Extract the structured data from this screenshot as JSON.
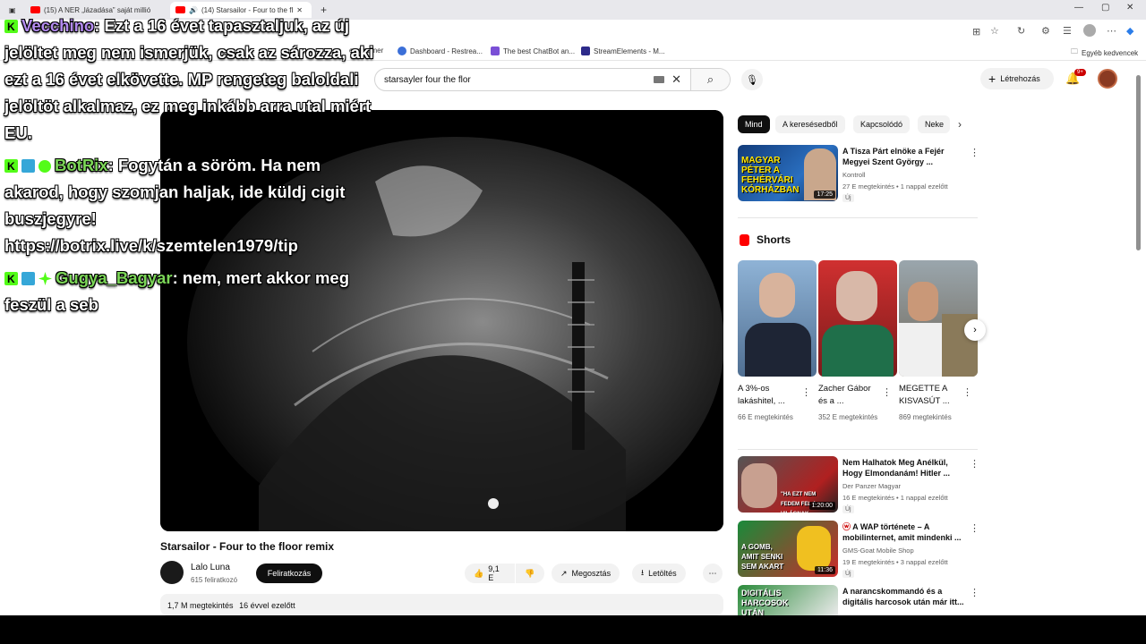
{
  "browser": {
    "tabs": [
      {
        "label": "(15) A NER „lázadása” saját millió"
      },
      {
        "label": "(14) Starsailor - Four to the fl"
      }
    ],
    "new_tab": "+",
    "bookmarks": [
      {
        "label": "e streamer"
      },
      {
        "label": "Dashboard - Restrea..."
      },
      {
        "label": "The best ChatBot an..."
      },
      {
        "label": "StreamElements - M..."
      }
    ],
    "other_favorites": "Egyéb kedvencek"
  },
  "header": {
    "search_query": "starsayler four the flor",
    "create_label": "Létrehozás",
    "notif_badge": "9+"
  },
  "video": {
    "title": "Starsailor - Four to the floor remix",
    "channel": "Lalo Luna",
    "subscribers": "615 feliratkozó",
    "subscribe_label": "Feliratkozás",
    "likes": "9,1 E",
    "share_label": "Megosztás",
    "download_label": "Letöltés",
    "views": "1,7 M megtekintés",
    "age": "16 évvel ezelőtt"
  },
  "chips": [
    "Mind",
    "A keresésedből",
    "Kapcsolódó",
    "Neke"
  ],
  "related_top": {
    "title": "A Tisza Párt elnöke a Fejér Megyei Szent György ...",
    "channel": "Kontroll",
    "meta": "27 E megtekintés • 1 nappal ezelőtt",
    "badge": "Új",
    "duration": "17:25",
    "thumb_text": "MAGYAR PÉTER A FEHÉRVÁRI KÓRHÁZBAN"
  },
  "shorts": {
    "title": "Shorts",
    "items": [
      {
        "title": "A 3%-os lakáshitel, ...",
        "views": "66 E megtekintés"
      },
      {
        "title": "Zacher Gábor és a ...",
        "views": "352 E megtekintés"
      },
      {
        "title": "MEGETTE A KISVASÚT ...",
        "views": "869 megtekintés"
      }
    ]
  },
  "related": [
    {
      "title": "Nem Halhatok Meg Anélkül, Hogy Elmondanám! Hitler ...",
      "channel": "Der Panzer Magyar",
      "meta": "16 E megtekintés • 1 nappal ezelőtt",
      "badge": "Új",
      "duration": "1:20:00",
      "thumb_text": "\"HA EZT NEM FEDEM FEL A VILÁGNAK"
    },
    {
      "title": "A WAP története – A mobilinternet, amit mindenki ...",
      "channel": "GMS-Goat Mobile Shop",
      "meta": "19 E megtekintés • 3 nappal ezelőtt",
      "badge": "Új",
      "duration": "11:36",
      "thumb_text": "A GOMB, AMIT SENKI SEM AKART"
    },
    {
      "title": "A narancskommandó és a digitális harcosok után már itt...",
      "channel": "",
      "meta": "",
      "badge": "",
      "duration": "",
      "thumb_text": "DIGITÁLIS HARCOSOK UTÁN"
    }
  ],
  "chat": [
    {
      "user": "Vecchino",
      "text": ": Ezt a 16 évet tapasztaljuk, az új jelöltet meg nem ismerjük, csak az sározza, aki ezt a 16 évet elkövette. MP rengeteg baloldali jelöltöt alkalmaz, ez meg inkább arra utal miért EU."
    },
    {
      "user": "BotRix",
      "text": ": Fogytán a söröm. Ha nem akarod, hogy szomjan haljak, ide küldj cigit buszjegyre! https://botrix.live/k/szemtelen1979/tip"
    },
    {
      "user": "Gugya_Bagyar",
      "text": ": nem, mert akkor meg feszül a seb"
    }
  ],
  "colors": {
    "accent": "#ff0000",
    "kick_green": "#53fc18",
    "vecchino": "#b48cf0",
    "botrix": "#7bd657"
  }
}
